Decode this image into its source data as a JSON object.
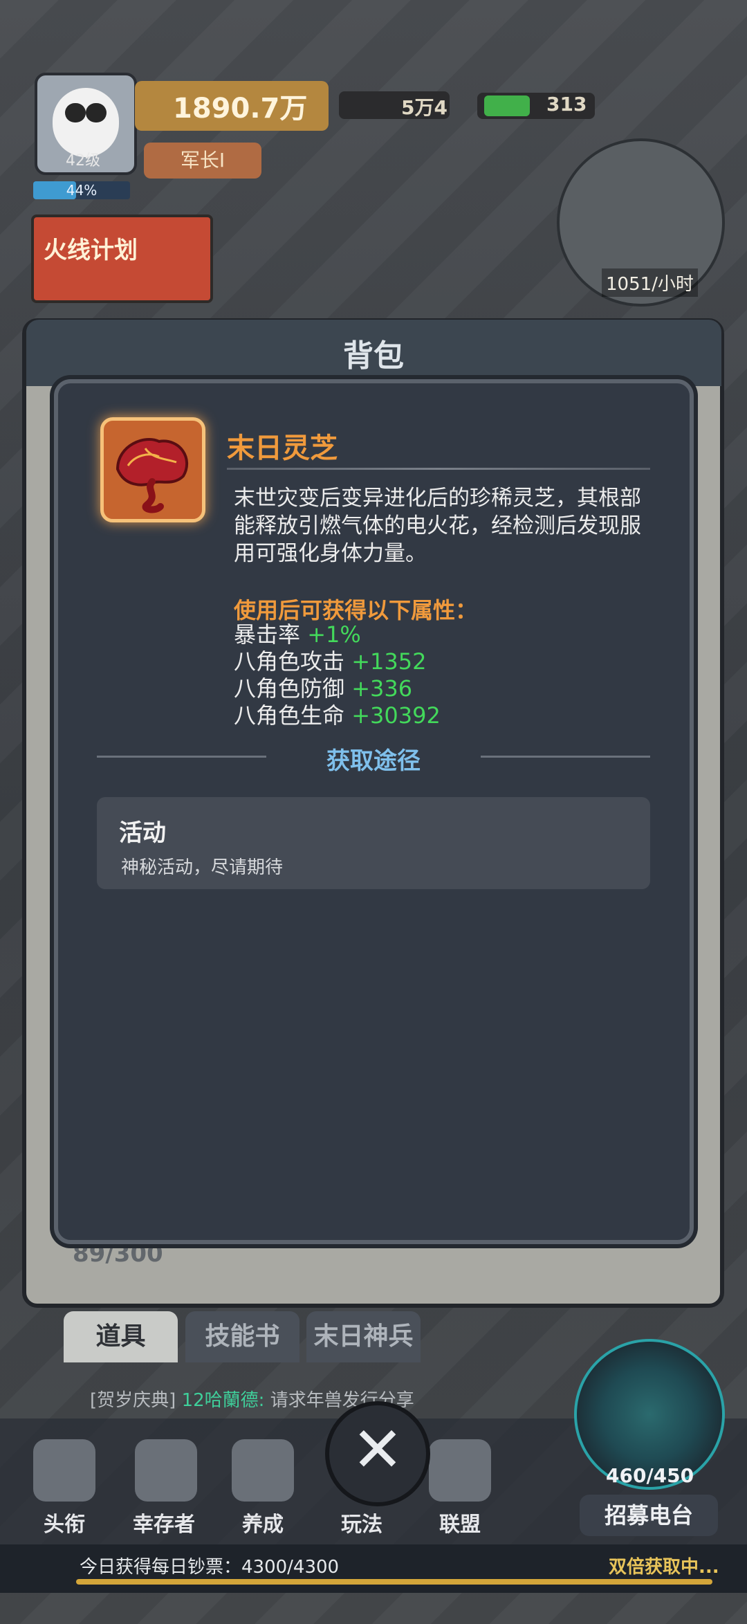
{
  "hud": {
    "level": "42级",
    "exp_percent": "44%",
    "exp_progress": 0.44,
    "power": "1890.7万",
    "rank": "军长Ⅰ",
    "gems": "5万4",
    "wood": "313",
    "production": "1051/小时",
    "event_banner": "火线计划"
  },
  "backpack": {
    "title": "背包",
    "capacity": "89/300",
    "tabs": [
      {
        "label": "道具",
        "active": true
      },
      {
        "label": "技能书",
        "active": false
      },
      {
        "label": "末日神兵",
        "active": false
      }
    ]
  },
  "item": {
    "name": "末日灵芝",
    "icon": "mushroom-icon",
    "description": "末世灾变后变异进化后的珍稀灵芝，其根部能释放引燃气体的电火花，经检测后发现服用可强化身体力量。",
    "effect_heading": "使用后可获得以下属性：",
    "stats": [
      {
        "name": "暴击率",
        "value": "+1%"
      },
      {
        "name": "八角色攻击",
        "value": "+1352"
      },
      {
        "name": "八角色防御",
        "value": "+336"
      },
      {
        "name": "八角色生命",
        "value": "+30392"
      }
    ],
    "source_heading": "获取途径",
    "source": {
      "title": "活动",
      "desc": "神秘活动，尽请期待"
    }
  },
  "chat": {
    "tag": "[贺岁庆典]",
    "name": "12哈蘭德:",
    "message": "请求年兽发行分享"
  },
  "nav": {
    "items": [
      "头衔",
      "幸存者",
      "养成",
      "玩法",
      "联盟"
    ],
    "close_symbol": "✕",
    "recruit": "招募电台",
    "radar_count": "460/450"
  },
  "daily": {
    "label": "今日获得每日钞票：4300/4300",
    "double": "双倍获取中..."
  },
  "colors": {
    "item_name": "#f09a3c",
    "stat_plus": "#43d95b",
    "source_heading": "#7fc0ec",
    "popup_bg": "#323944"
  }
}
